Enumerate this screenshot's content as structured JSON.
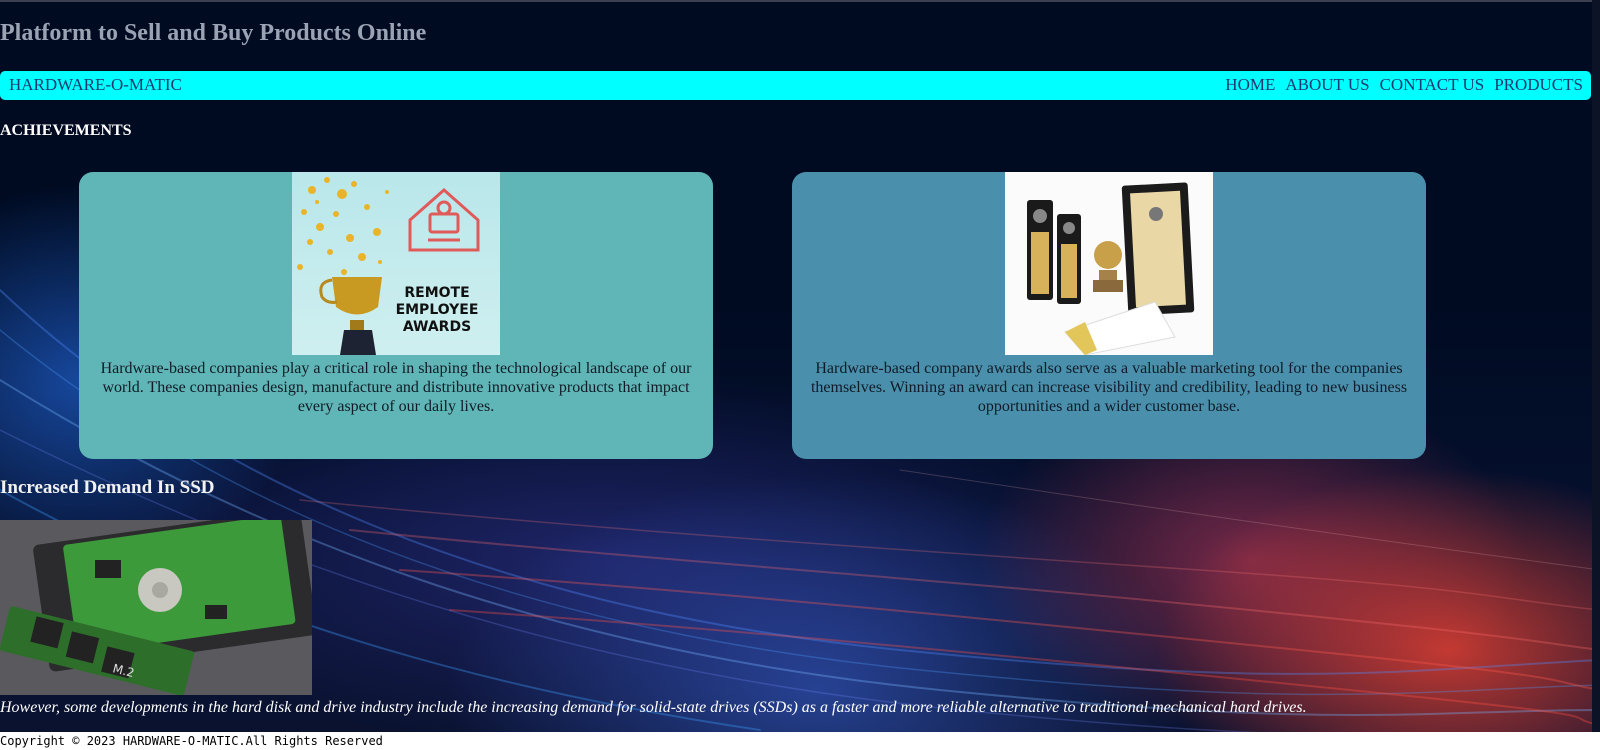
{
  "header": {
    "site_title": "Platform to Sell and Buy Products Online"
  },
  "navbar": {
    "brand": "HARDWARE-O-MATIC",
    "links": [
      "HOME",
      "ABOUT US",
      "CONTACT US",
      "PRODUCTS"
    ]
  },
  "achievements": {
    "heading": "ACHIEVEMENTS",
    "cards": [
      {
        "image_text": [
          "REMOTE",
          "EMPLOYEE",
          "AWARDS"
        ],
        "text": "Hardware-based companies play a critical role in shaping the technological landscape of our world. These companies design, manufacture and distribute innovative products that impact every aspect of our daily lives.",
        "background": "#60b5b6"
      },
      {
        "text": "Hardware-based company awards also serve as a valuable marketing tool for the companies themselves. Winning an award can increase visibility and credibility, leading to new business opportunities and a wider customer base.",
        "background": "#4a8fac"
      }
    ]
  },
  "ssd": {
    "heading": "Increased Demand In SSD",
    "ssd_label": "M.2",
    "text": "However, some developments in the hard disk and drive industry include the increasing demand for solid-state drives (SSDs) as a faster and more reliable alternative to traditional mechanical hard drives."
  },
  "footer": {
    "copyright": "Copyright © 2023 HARDWARE-O-MATIC.All Rights Reserved"
  },
  "colors": {
    "navbar": "#00ffff",
    "nav_text": "#1d3a6e",
    "background": "#000b22"
  }
}
